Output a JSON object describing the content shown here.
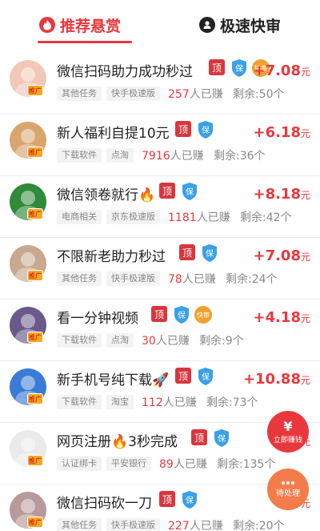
{
  "tabs": [
    {
      "label": "推荐悬赏",
      "icon": "flame-icon",
      "active": true
    },
    {
      "label": "极速快审",
      "icon": "person-icon",
      "active": false
    }
  ],
  "colors": {
    "accent": "#e8383d",
    "top_badge": "#d9363e",
    "bao_badge": "#3aa0e8",
    "kuai_badge": "#f0a030"
  },
  "badges": {
    "top": "顶",
    "bao": "保",
    "kuai": "快审",
    "avatar": "推广"
  },
  "earned_suffix": "人已赚",
  "remain_prefix": "剩余:",
  "remain_suffix": "个",
  "currency": "元",
  "tasks": [
    {
      "title": "微信扫码助力成功秒过",
      "kuai": true,
      "amount": "+7.08",
      "tags": [
        "其他任务",
        "快手极速版"
      ],
      "earned": "257",
      "remain": "50"
    },
    {
      "title": "新人福利自提10元",
      "kuai": false,
      "amount": "+6.18",
      "tags": [
        "下载软件",
        "点淘"
      ],
      "earned": "7916",
      "remain": "36"
    },
    {
      "title": "微信领卷就行🔥",
      "kuai": false,
      "amount": "+8.18",
      "tags": [
        "电商相关",
        "京东极速版"
      ],
      "earned": "1181",
      "remain": "42"
    },
    {
      "title": "不限新老助力秒过",
      "kuai": false,
      "amount": "+7.08",
      "tags": [
        "其他任务",
        "快手极速版"
      ],
      "earned": "78",
      "remain": "24"
    },
    {
      "title": "看一分钟视频",
      "kuai": true,
      "amount": "+4.18",
      "tags": [
        "下载软件",
        "点淘"
      ],
      "earned": "30",
      "remain": "9"
    },
    {
      "title": "新手机号纯下载🚀",
      "kuai": false,
      "amount": "+10.88",
      "tags": [
        "下载软件",
        "淘宝"
      ],
      "earned": "112",
      "remain": "73"
    },
    {
      "title": "网页注册🔥3秒完成",
      "kuai": false,
      "amount": "+",
      "tags": [
        "认证绑卡",
        "平安银行"
      ],
      "earned": "89",
      "remain": "135"
    },
    {
      "title": "微信扫码砍一刀",
      "kuai": false,
      "amount": "+7.",
      "tags": [
        "其他任务",
        "快手极速版"
      ],
      "earned": "227",
      "remain": "20"
    }
  ],
  "float_earn": {
    "symbol": "¥",
    "label": "立即赚钱"
  },
  "float_pending": {
    "label": "待处理"
  }
}
